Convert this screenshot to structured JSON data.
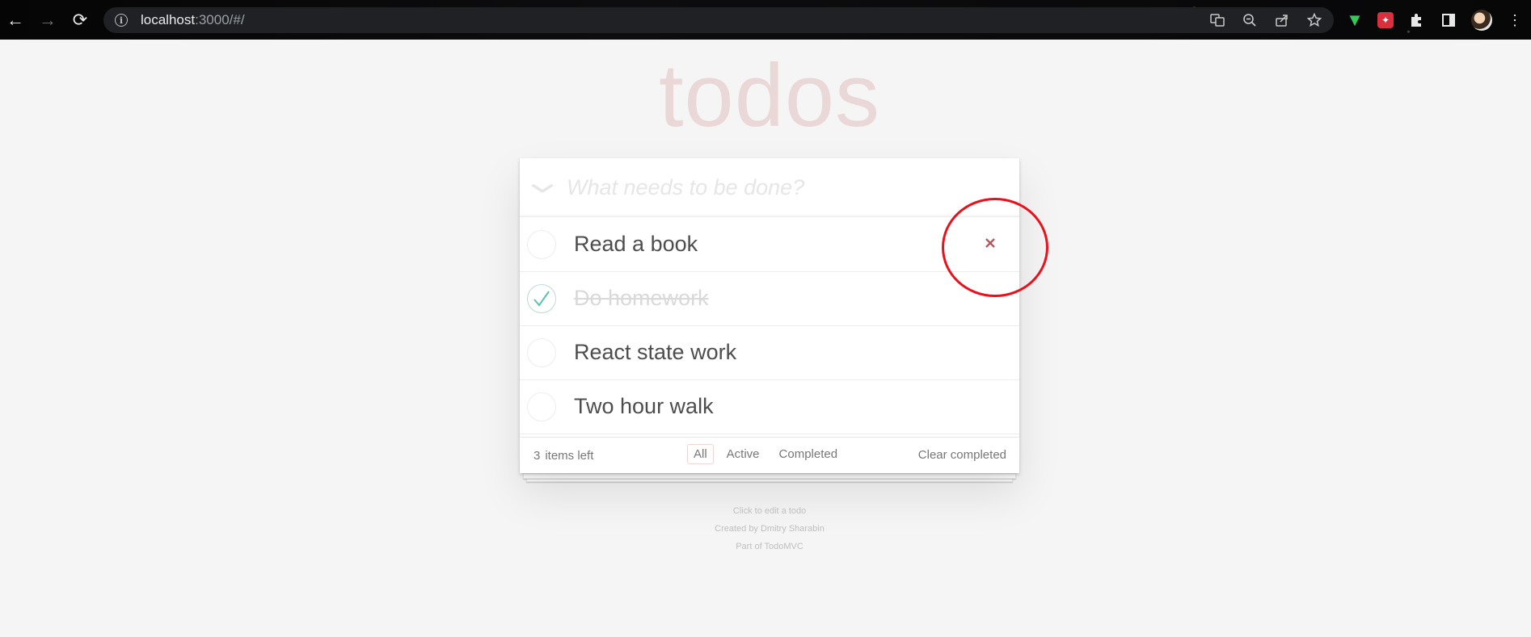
{
  "browser": {
    "url_host": "localhost",
    "url_rest": ":3000/#/",
    "nav": {
      "back": "←",
      "forward": "→",
      "reload": "⟳"
    },
    "omnibox_icons": [
      "translate-icon",
      "zoom-out-icon",
      "share-icon",
      "star-icon"
    ],
    "extension_icons": [
      "download-extension-icon",
      "red-extension-icon",
      "puzzle-extension-icon",
      "sidepanel-icon",
      "profile-avatar"
    ]
  },
  "app": {
    "title": "todos",
    "new_todo_placeholder": "What needs to be done?",
    "toggle_all_glyph": "❯",
    "todos": [
      {
        "label": "Read a book",
        "completed": false
      },
      {
        "label": "Do homework",
        "completed": true
      },
      {
        "label": "React state work",
        "completed": false
      },
      {
        "label": "Two hour walk",
        "completed": false
      }
    ],
    "destroy_glyph": "×",
    "footer": {
      "count": "3",
      "count_suffix": "items left",
      "filters": [
        "All",
        "Active",
        "Completed"
      ],
      "selected_filter": "All",
      "clear_completed": "Clear completed"
    }
  },
  "info": {
    "line1": "Click to edit a todo",
    "line2": "Created by Dmitry Sharabin",
    "line3": "Part of TodoMVC"
  },
  "colors": {
    "title": "#af2f2f",
    "annotation_circle": "#e8111c",
    "checkmark": "#5dc2af",
    "destroy": "#af5b5e"
  }
}
